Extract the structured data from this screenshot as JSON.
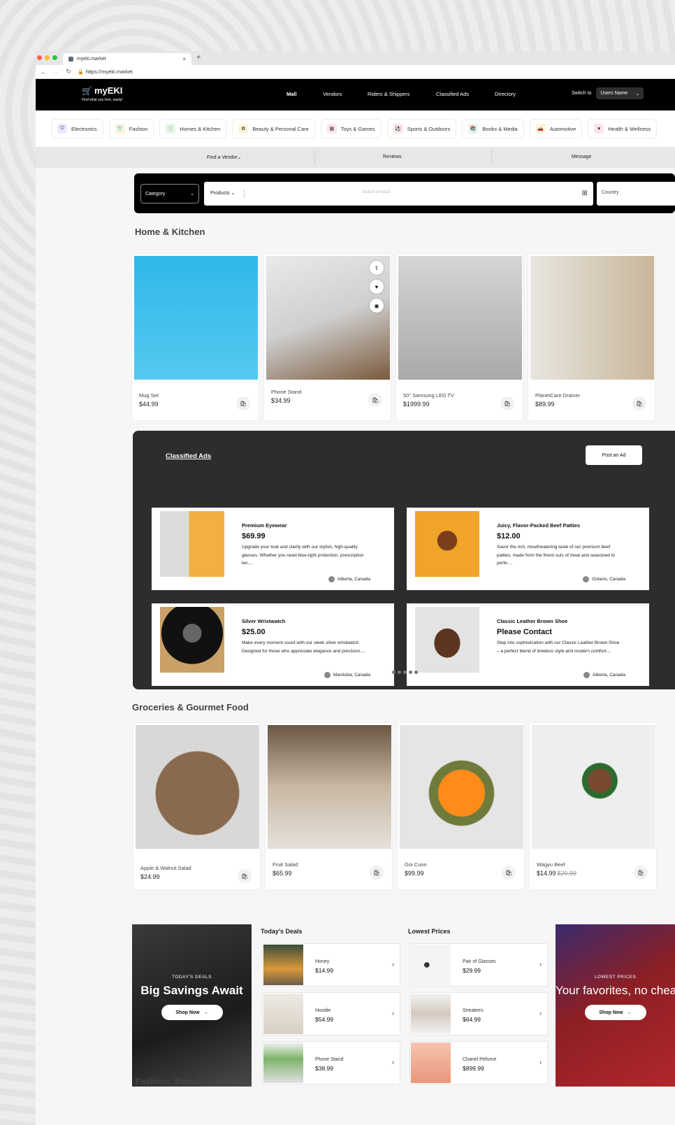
{
  "browser": {
    "tab_title": "myeki.market",
    "url": "https://myeki.market"
  },
  "header": {
    "brand": "myEKI",
    "tagline": "Find what you love, easily!",
    "nav": [
      "Mall",
      "Vendors",
      "Riders & Shippers",
      "Classified Ads",
      "Directory"
    ],
    "switch_label": "Switch to",
    "switch_value": "Users Name"
  },
  "categories": [
    {
      "label": "Electronics",
      "color": "#ece7ff",
      "icon": "power-icon"
    },
    {
      "label": "Fashion",
      "color": "#fff4d6",
      "icon": "shirt-icon"
    },
    {
      "label": "Homes & Kitchen",
      "color": "#e3f5e7",
      "icon": "fork-icon"
    },
    {
      "label": "Beauty & Personal Care",
      "color": "#fff4d6",
      "icon": "beauty-icon"
    },
    {
      "label": "Toys & Games",
      "color": "#ffe3ee",
      "icon": "toy-icon"
    },
    {
      "label": "Sports & Outdoors",
      "color": "#ffe6e6",
      "icon": "sports-icon"
    },
    {
      "label": "Books & Media",
      "color": "#e3f5e7",
      "icon": "book-icon"
    },
    {
      "label": "Automotive",
      "color": "#fff4d6",
      "icon": "car-icon"
    },
    {
      "label": "Health & Wellness",
      "color": "#ffe3ee",
      "icon": "heart-icon"
    }
  ],
  "subnav": [
    "Find a Vendor",
    "Reviews",
    "Message"
  ],
  "search": {
    "category": "Category",
    "products": "Products",
    "placeholder": "Search product",
    "country": "Country"
  },
  "home_kitchen": {
    "title": "Home & Kitchen",
    "products": [
      {
        "name": "Mug Set",
        "price": "$44.99"
      },
      {
        "name": "Phone Stand",
        "price": "$34.99"
      },
      {
        "name": "50\" Samsung LED TV",
        "price": "$1999.99"
      },
      {
        "name": "PlanetCare Drainer",
        "price": "$89.99"
      }
    ]
  },
  "classified": {
    "title": "Classified Ads",
    "post_label": "Post an Ad",
    "ads": [
      {
        "title": "Premium Eyewear",
        "price": "$69.99",
        "desc": "Upgrade your look and clarity with our stylish, high-quality glasses. Whether you need blue-light protection, prescription len....",
        "location": "Alberta, Canada"
      },
      {
        "title": "Juicy, Flavor-Packed Beef Patties",
        "price": "$12.00",
        "desc": "Savor the rich, mouthwatering taste of our premium beef patties, made from the finest cuts of meat and seasoned to perfe....",
        "location": "Ontario, Canada"
      },
      {
        "title": "Silver Wristwatch",
        "price": "$25.00",
        "desc": "Make every moment count with our sleek silver wristwatch. Designed for those who appreciate elegance and precision....",
        "location": "Manitoba, Canada"
      },
      {
        "title": "Classic Leather Brown Shoe",
        "price": "Please Contact",
        "desc": "Step into sophistication with our Classic Leather Brown Shoe – a perfect blend of timeless style and modern comfort....",
        "location": "Alberta, Canada"
      }
    ]
  },
  "groceries": {
    "title": "Groceries & Gourmet Food",
    "products": [
      {
        "name": "Apple & Walnut Salad",
        "price": "$24.99",
        "old_price": ""
      },
      {
        "name": "Fruit Salad",
        "price": "$65.99",
        "old_price": ""
      },
      {
        "name": "Goi Cuon",
        "price": "$99.99",
        "old_price": ""
      },
      {
        "name": "Wagyu Beef",
        "price": "$14.99",
        "old_price": "$20.99"
      }
    ]
  },
  "deals": {
    "promo_left": {
      "eyebrow": "TODAY'S DEALS",
      "headline": "Big Savings Await",
      "button": "Shop Now"
    },
    "promo_right": {
      "eyebrow": "LOWEST PRICES",
      "headline": "Your favorites, no cheaper!",
      "button": "Shop Now"
    },
    "todays_title": "Today's Deals",
    "todays": [
      {
        "name": "Honey",
        "price": "$14.99"
      },
      {
        "name": "Hoodie",
        "price": "$54.99"
      },
      {
        "name": "Phone Stand",
        "price": "$38.99"
      }
    ],
    "lowest_title": "Lowest Prices",
    "lowest": [
      {
        "name": "Pair of Glasses",
        "price": "$29.99"
      },
      {
        "name": "Sneakers",
        "price": "$64.99"
      },
      {
        "name": "Chanel Pefume",
        "price": "$899.99"
      }
    ]
  },
  "fashion_title": "Fashion, Beauty & Health"
}
